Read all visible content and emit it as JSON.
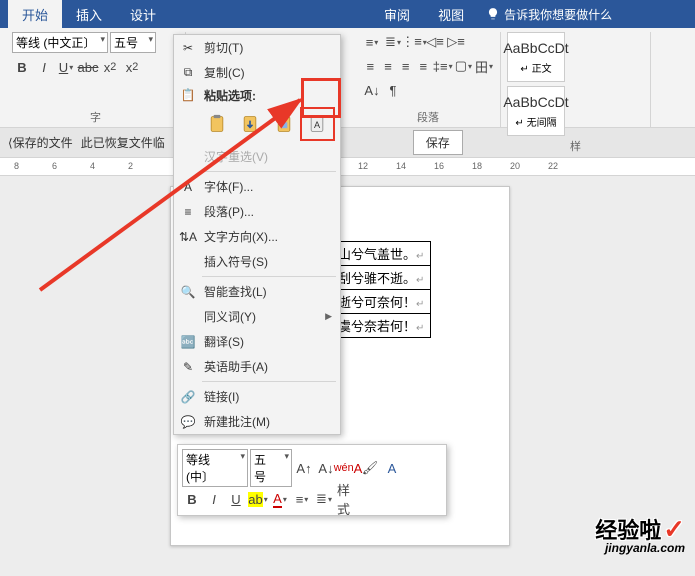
{
  "tabs": {
    "start": "开始",
    "insert": "插入",
    "design": "设计",
    "review": "审阅",
    "view": "视图",
    "tell_me": "告诉我你想要做什么"
  },
  "font": {
    "name": "等线 (中文正〕",
    "size": "五号",
    "group_label": "字"
  },
  "paragraph": {
    "group_label": "段落"
  },
  "styles": {
    "group_label": "样",
    "items": [
      {
        "preview": "AaBbCcDt",
        "name": "↵ 正文"
      },
      {
        "preview": "AaBbCcDt",
        "name": "↵ 无间隔"
      }
    ]
  },
  "subbar": {
    "unsaved": "⟨保存的文件",
    "recovered": "此已恢复文件临",
    "save": "保存"
  },
  "ruler": {
    "marks": [
      "8",
      "6",
      "4",
      "2",
      "12",
      "14",
      "16",
      "18",
      "20",
      "22"
    ]
  },
  "context_menu": {
    "cut": "剪切(T)",
    "copy": "复制(C)",
    "paste_header": "粘贴选项:",
    "hanzi": "汉字重选(V)",
    "font": "字体(F)...",
    "paragraph": "段落(P)...",
    "text_dir": "文字方向(X)...",
    "insert_symbol": "插入符号(S)",
    "smart_lookup": "智能查找(L)",
    "synonyms": "同义词(Y)",
    "translate": "翻译(S)",
    "eng_assist": "英语助手(A)",
    "link": "链接(I)",
    "new_comment": "新建批注(M)"
  },
  "doc": {
    "rows": [
      "山兮气盖世。",
      "刮兮骓不逝。",
      "逝兮可奈何！",
      "虞兮奈若何！"
    ]
  },
  "mini": {
    "font_name": "等线 (中〕",
    "font_size": "五号",
    "styles_label": "样式"
  },
  "watermark": {
    "top": "经验啦",
    "bottom": "jingyanla.com"
  }
}
